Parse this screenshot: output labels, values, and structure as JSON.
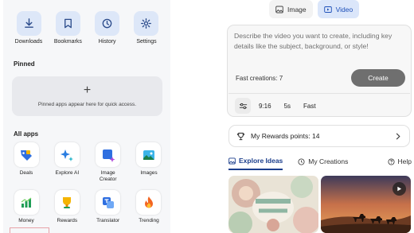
{
  "quick_actions": [
    {
      "label": "Downloads",
      "icon": "download-icon"
    },
    {
      "label": "Bookmarks",
      "icon": "bookmark-icon"
    },
    {
      "label": "History",
      "icon": "history-icon"
    },
    {
      "label": "Settings",
      "icon": "gear-icon"
    }
  ],
  "pinned": {
    "title": "Pinned",
    "empty_text": "Pinned apps appear here for quick access."
  },
  "all_apps": {
    "title": "All apps",
    "items": [
      {
        "label": "Deals",
        "icon": "deals-tag-icon"
      },
      {
        "label": "Explore AI",
        "icon": "sparkle-icon"
      },
      {
        "label": "Image Creator",
        "icon": "image-creator-icon"
      },
      {
        "label": "Images",
        "icon": "images-icon"
      },
      {
        "label": "Money",
        "icon": "money-chart-icon"
      },
      {
        "label": "Rewards",
        "icon": "rewards-trophy-icon"
      },
      {
        "label": "Translator",
        "icon": "translator-icon"
      },
      {
        "label": "Trending",
        "icon": "trending-flame-icon"
      }
    ]
  },
  "creator": {
    "mode_tabs": [
      {
        "label": "Image",
        "icon": "image-icon",
        "active": false
      },
      {
        "label": "Video",
        "icon": "video-icon",
        "active": true
      }
    ],
    "prompt_placeholder": "Describe the video you want to create, including key details like the subject, background, or style!",
    "fast_creations": "Fast creations: 7",
    "create_label": "Create",
    "options": {
      "aspect_ratio": "9:16",
      "duration": "5s",
      "speed": "Fast"
    }
  },
  "rewards": {
    "label": "My Rewards points: 14"
  },
  "feed_tabs": [
    {
      "label": "Explore Ideas",
      "icon": "explore-icon",
      "active": true
    },
    {
      "label": "My Creations",
      "icon": "history-icon",
      "active": false
    },
    {
      "label": "Help",
      "icon": "help-icon",
      "active": false
    }
  ],
  "thumbnails": [
    {
      "name": "summer-flowers-thumbnail"
    },
    {
      "name": "desert-camels-thumbnail",
      "has_play": true
    }
  ],
  "colors": {
    "accent": "#1b3e8c",
    "toggle_active_bg": "#dbe6fa",
    "create_button": "#6f6f6f",
    "panel_bg": "#f6f7f9"
  }
}
